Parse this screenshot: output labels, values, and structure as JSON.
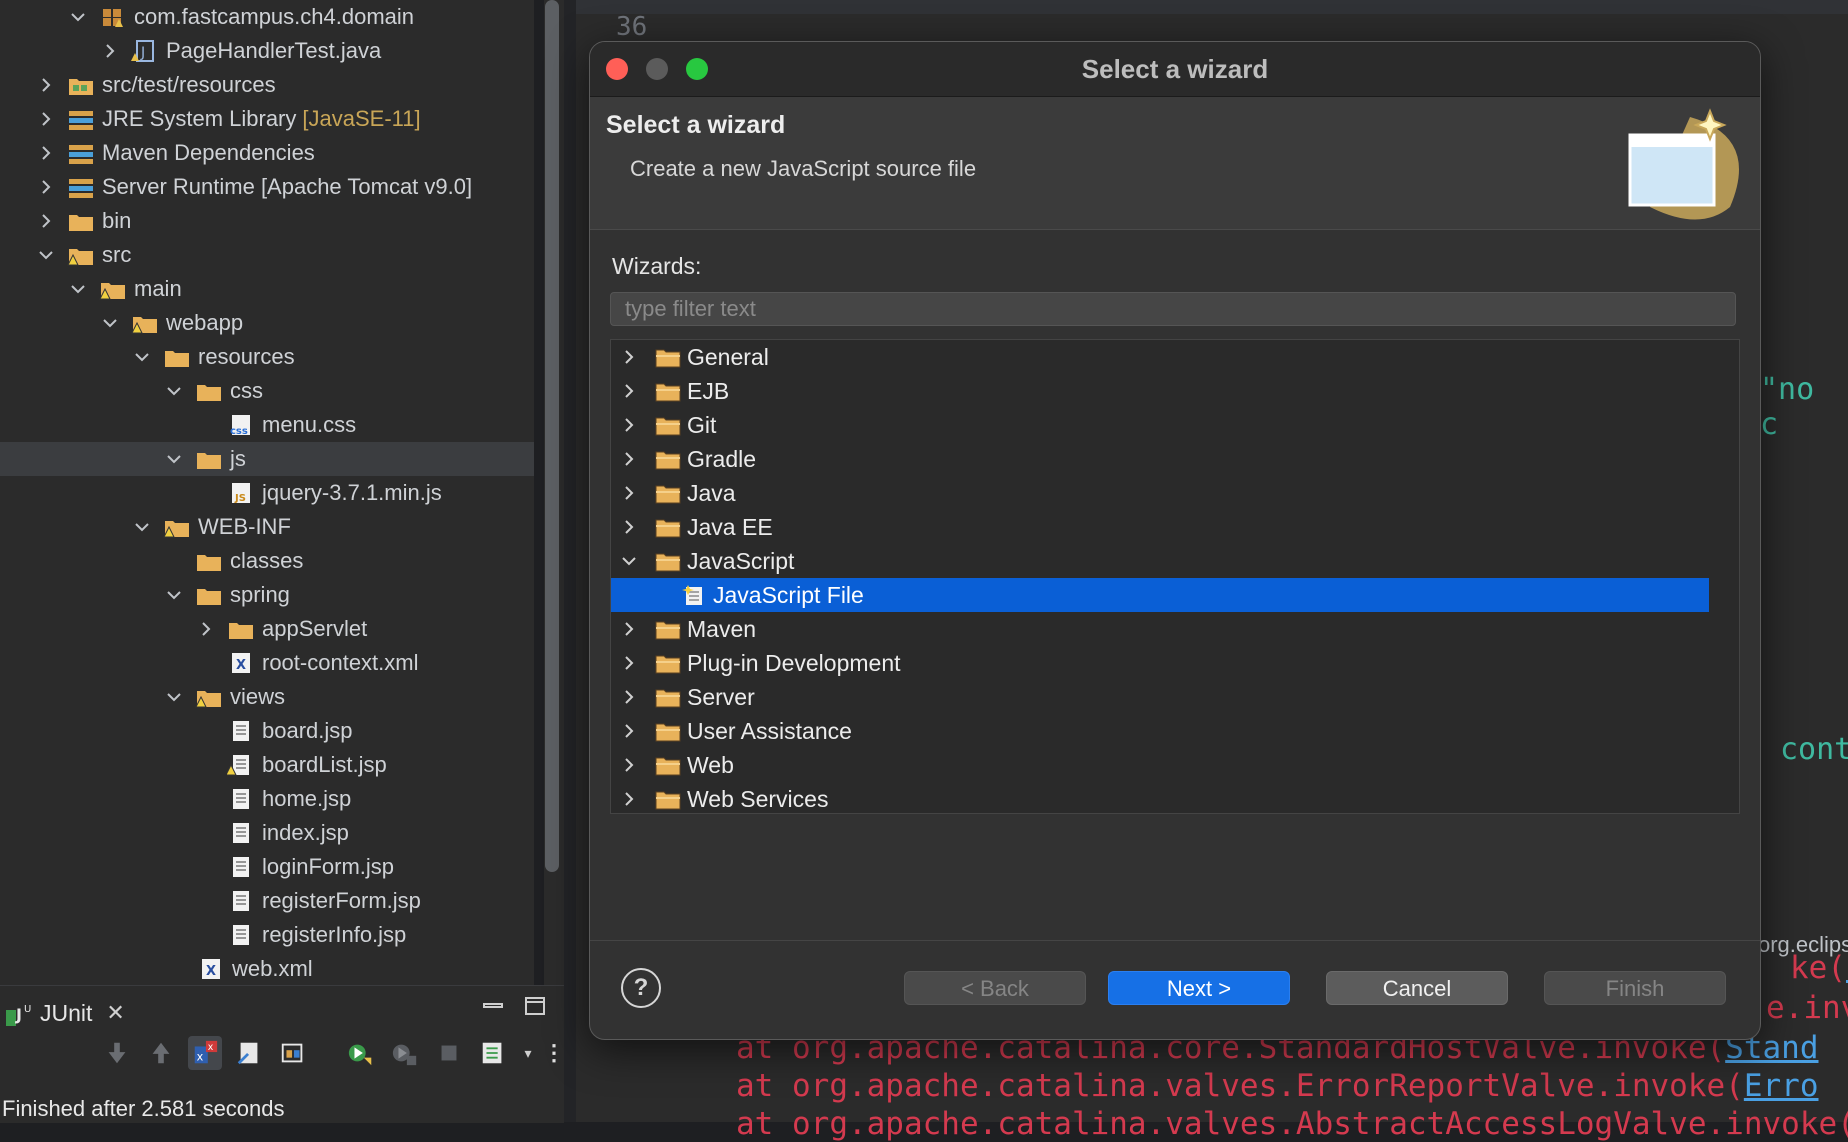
{
  "explorer": {
    "rows": [
      {
        "label": "com.fastcampus.ch4.domain",
        "accent": ""
      },
      {
        "label": "PageHandlerTest.java",
        "accent": ""
      },
      {
        "label": "src/test/resources",
        "accent": ""
      },
      {
        "label": "JRE System Library",
        "accent": "[JavaSE-11]"
      },
      {
        "label": "Maven Dependencies",
        "accent": ""
      },
      {
        "label": "Server Runtime [Apache Tomcat v9.0]",
        "accent": ""
      },
      {
        "label": "bin",
        "accent": ""
      },
      {
        "label": "src",
        "accent": ""
      },
      {
        "label": "main",
        "accent": ""
      },
      {
        "label": "webapp",
        "accent": ""
      },
      {
        "label": "resources",
        "accent": ""
      },
      {
        "label": "css",
        "accent": ""
      },
      {
        "label": "menu.css",
        "accent": ""
      },
      {
        "label": "js",
        "accent": ""
      },
      {
        "label": "jquery-3.7.1.min.js",
        "accent": ""
      },
      {
        "label": "WEB-INF",
        "accent": ""
      },
      {
        "label": "classes",
        "accent": ""
      },
      {
        "label": "spring",
        "accent": ""
      },
      {
        "label": "appServlet",
        "accent": ""
      },
      {
        "label": "root-context.xml",
        "accent": ""
      },
      {
        "label": "views",
        "accent": ""
      },
      {
        "label": "board.jsp",
        "accent": ""
      },
      {
        "label": "boardList.jsp",
        "accent": ""
      },
      {
        "label": "home.jsp",
        "accent": ""
      },
      {
        "label": "index.jsp",
        "accent": ""
      },
      {
        "label": "loginForm.jsp",
        "accent": ""
      },
      {
        "label": "registerForm.jsp",
        "accent": ""
      },
      {
        "label": "registerInfo.jsp",
        "accent": ""
      },
      {
        "label": "web.xml",
        "accent": ""
      }
    ]
  },
  "junit": {
    "tab_label": "JUnit",
    "status": "Finished after 2.581 seconds"
  },
  "editor": {
    "line_number": "36",
    "code_fragment_string": "\"no c",
    "code_fragment_cont": "cont",
    "console_header": "org.eclips",
    "console_lines": [
      {
        "prefix": "at org.apache.catalina.core.StandardHostValve.invoke(",
        "link": "Stand"
      },
      {
        "prefix": "at org.apache.catalina.valves.ErrorReportValve.invoke(",
        "link": "Erro"
      },
      {
        "prefix": "at org.apache.catalina.valves.AbstractAccessLogValve.invoke(",
        "link": ""
      }
    ],
    "console_right": [
      {
        "prefix": "ke(",
        "link": "St"
      },
      {
        "prefix": "e.inv",
        "link": ""
      }
    ]
  },
  "dialog": {
    "title": "Select a wizard",
    "banner_title": "Select a wizard",
    "banner_description": "Create a new JavaScript source file",
    "wizards_label": "Wizards:",
    "filter_placeholder": "type filter text",
    "filter_value": "",
    "wizards": [
      {
        "label": "General",
        "type": "folder",
        "expanded": false
      },
      {
        "label": "EJB",
        "type": "folder",
        "expanded": false
      },
      {
        "label": "Git",
        "type": "folder",
        "expanded": false
      },
      {
        "label": "Gradle",
        "type": "folder",
        "expanded": false
      },
      {
        "label": "Java",
        "type": "folder",
        "expanded": false
      },
      {
        "label": "Java EE",
        "type": "folder",
        "expanded": false
      },
      {
        "label": "JavaScript",
        "type": "folder",
        "expanded": true
      },
      {
        "label": "JavaScript File",
        "type": "wizard",
        "selected": true
      },
      {
        "label": "Maven",
        "type": "folder",
        "expanded": false
      },
      {
        "label": "Plug-in Development",
        "type": "folder",
        "expanded": false
      },
      {
        "label": "Server",
        "type": "folder",
        "expanded": false
      },
      {
        "label": "User Assistance",
        "type": "folder",
        "expanded": false
      },
      {
        "label": "Web",
        "type": "folder",
        "expanded": false
      },
      {
        "label": "Web Services",
        "type": "folder",
        "expanded": false
      }
    ],
    "buttons": {
      "help": "?",
      "back": "< Back",
      "next": "Next >",
      "cancel": "Cancel",
      "finish": "Finish"
    }
  },
  "colors": {
    "selection": "#0a5fd6",
    "primary_button": "#1670e6",
    "folder": "#e8b25a",
    "error_text": "#d43a4f",
    "link_text": "#4aa0e3"
  }
}
